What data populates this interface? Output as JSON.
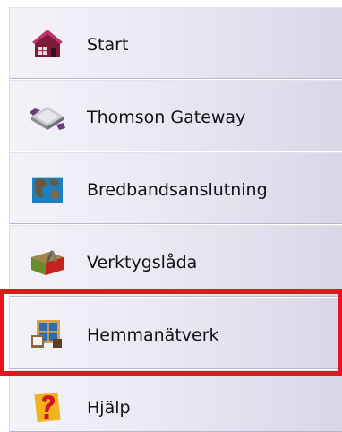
{
  "nav": {
    "items": [
      {
        "label": "Start",
        "icon": "house-icon"
      },
      {
        "label": "Thomson Gateway",
        "icon": "gateway-device-icon"
      },
      {
        "label": "Bredbandsanslutning",
        "icon": "globe-icon"
      },
      {
        "label": "Verktygslåda",
        "icon": "toolbox-icon"
      },
      {
        "label": "Hemmanätverk",
        "icon": "home-network-window-icon"
      },
      {
        "label": "Hjälp",
        "icon": "question-mark-icon"
      }
    ],
    "highlighted_item": "Hemmanätverk"
  },
  "colors": {
    "highlight_border": "#e8141c",
    "item_background": "#e9e7f1",
    "text": "#111111"
  }
}
